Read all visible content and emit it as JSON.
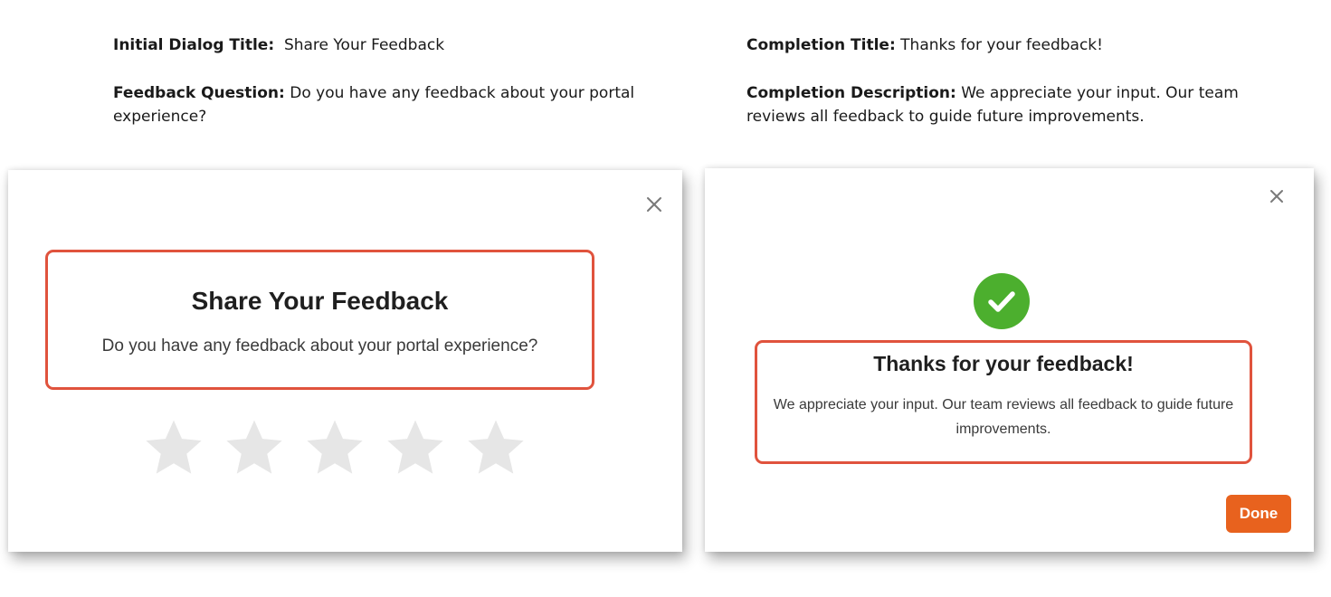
{
  "annotations": {
    "left": {
      "title_label": "Initial Dialog Title:",
      "title_value": "Share Your Feedback",
      "question_label": "Feedback Question:",
      "question_value": "Do you have any feedback about your portal experience?"
    },
    "right": {
      "title_label": "Completion Title:",
      "title_value": "Thanks for your feedback!",
      "description_label": "Completion Description:",
      "description_value": "We appreciate your input. Our team reviews all feedback to guide future improvements."
    }
  },
  "initial_dialog": {
    "title": "Share Your Feedback",
    "question": "Do you have any feedback about your portal experience?",
    "close_icon": "close-icon",
    "rating": {
      "max_stars": 5,
      "selected": 0
    }
  },
  "completion_dialog": {
    "title": "Thanks for your feedback!",
    "description": "We appreciate your input. Our team reviews all feedback to guide future improvements.",
    "close_icon": "close-icon",
    "status_icon": "check-circle-icon",
    "done_label": "Done"
  },
  "colors": {
    "highlight_border": "#e0533d",
    "check_green": "#4caf2e",
    "done_button": "#e8621e",
    "star_empty": "#e6e6e6",
    "close_icon": "#7a7a7a"
  }
}
